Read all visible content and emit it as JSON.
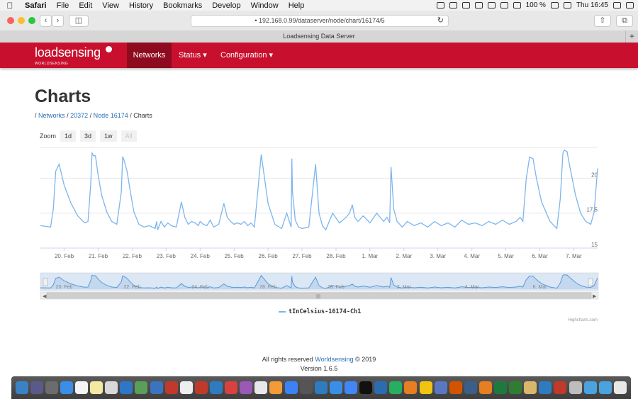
{
  "menubar": {
    "items": [
      "Safari",
      "File",
      "Edit",
      "View",
      "History",
      "Bookmarks",
      "Develop",
      "Window",
      "Help"
    ],
    "battery": "100 %",
    "clock": "Thu 16:45"
  },
  "browser": {
    "url": "192.168.0.99/dataserver/node/chart/16174/5",
    "tab_title": "Loadsensing Data Server"
  },
  "app": {
    "logo": "loadsensing",
    "logo_sub": "WORLDSENSING",
    "nav": {
      "networks": "Networks",
      "status": "Status ▾",
      "configuration": "Configuration ▾"
    }
  },
  "page": {
    "title": "Charts",
    "breadcrumb": {
      "sep": "/",
      "networks": "Networks",
      "network_id": "20372",
      "node": "Node 16174",
      "current": "Charts"
    },
    "zoom": {
      "label": "Zoom",
      "buttons": [
        "1d",
        "3d",
        "1w",
        "All"
      ]
    }
  },
  "chart_data": {
    "type": "line",
    "xlabel": "",
    "ylabel": "",
    "x_ticks": [
      "20. Feb",
      "21. Feb",
      "22. Feb",
      "23. Feb",
      "24. Feb",
      "25. Feb",
      "26. Feb",
      "27. Feb",
      "28. Feb",
      "1. Mar",
      "2. Mar",
      "3. Mar",
      "4. Mar",
      "5. Mar",
      "6. Mar",
      "7. Mar"
    ],
    "y_ticks": [
      15,
      17.5,
      20
    ],
    "ylim": [
      15,
      22.2
    ],
    "xlim": [
      -0.7,
      15.7
    ],
    "navigator_ticks": [
      "20. Feb",
      "22. Feb",
      "24. Feb",
      "26. Feb",
      "28. Feb",
      "2. Mar",
      "4. Mar",
      "6. Mar"
    ],
    "series": [
      {
        "name": "tInCelsius-16174-Ch1",
        "color": "#7cb5ec",
        "x": [
          -0.7,
          -0.4,
          -0.32,
          -0.25,
          -0.15,
          0.0,
          0.2,
          0.4,
          0.6,
          0.7,
          0.78,
          0.82,
          0.86,
          0.92,
          1.0,
          1.1,
          1.25,
          1.4,
          1.55,
          1.68,
          1.72,
          1.75,
          1.85,
          1.95,
          2.05,
          2.2,
          2.35,
          2.5,
          2.68,
          2.72,
          2.75,
          2.85,
          2.95,
          3.05,
          3.15,
          3.3,
          3.45,
          3.55,
          3.65,
          3.75,
          3.85,
          3.95,
          4.0,
          4.1,
          4.2,
          4.3,
          4.4,
          4.55,
          4.7,
          4.8,
          4.9,
          5.0,
          5.1,
          5.2,
          5.3,
          5.4,
          5.5,
          5.6,
          5.8,
          6.0,
          6.2,
          6.4,
          6.55,
          6.68,
          6.7,
          6.72,
          6.8,
          6.9,
          7.0,
          7.2,
          7.4,
          7.5,
          7.6,
          7.7,
          7.8,
          7.9,
          8.1,
          8.3,
          8.4,
          8.48,
          8.55,
          8.65,
          8.8,
          9.0,
          9.2,
          9.4,
          9.5,
          9.58,
          9.62,
          9.7,
          9.8,
          9.95,
          10.1,
          10.3,
          10.5,
          10.7,
          10.9,
          11.1,
          11.3,
          11.5,
          11.7,
          11.9,
          12.1,
          12.3,
          12.5,
          12.7,
          12.9,
          13.1,
          13.3,
          13.42,
          13.5,
          13.6,
          13.7,
          13.8,
          13.9,
          14.05,
          14.3,
          14.5,
          14.6,
          14.68,
          14.72,
          14.8,
          14.9,
          15.05,
          15.2,
          15.35,
          15.5,
          15.6,
          15.7
        ],
        "values": [
          16.6,
          16.5,
          17.8,
          20.5,
          21.0,
          19.5,
          18.2,
          17.3,
          16.8,
          16.9,
          19.5,
          21.8,
          21.6,
          21.6,
          20.2,
          18.8,
          17.6,
          16.9,
          16.7,
          19.0,
          21.5,
          21.4,
          20.5,
          19.0,
          17.6,
          16.7,
          16.5,
          16.6,
          16.4,
          16.9,
          16.3,
          16.9,
          16.5,
          16.8,
          16.6,
          16.5,
          18.3,
          17.2,
          16.7,
          16.9,
          16.8,
          16.6,
          16.9,
          16.7,
          16.6,
          17.0,
          16.5,
          16.7,
          18.2,
          17.2,
          16.9,
          16.7,
          16.8,
          16.7,
          16.9,
          16.6,
          16.8,
          16.5,
          21.7,
          18.2,
          16.7,
          16.4,
          17.5,
          16.5,
          21.4,
          19.0,
          17.0,
          16.5,
          16.4,
          16.5,
          21.0,
          17.5,
          16.6,
          16.3,
          16.9,
          17.5,
          16.8,
          17.2,
          17.5,
          18.1,
          17.2,
          16.9,
          17.3,
          16.8,
          17.5,
          16.9,
          17.2,
          16.8,
          20.8,
          17.8,
          16.9,
          16.5,
          16.9,
          16.6,
          16.8,
          16.5,
          16.9,
          16.6,
          16.8,
          16.5,
          17.0,
          16.7,
          16.8,
          16.6,
          16.9,
          16.7,
          17.0,
          16.7,
          16.9,
          17.2,
          16.9,
          20.0,
          21.5,
          21.4,
          20.0,
          18.3,
          16.9,
          16.4,
          18.5,
          21.8,
          22.0,
          21.9,
          20.6,
          18.8,
          17.5,
          16.9,
          16.7,
          17.6,
          20.7
        ]
      }
    ]
  },
  "legend": {
    "label": "tInCelsius-16174-Ch1"
  },
  "credits": "Highcharts.com",
  "footer": {
    "text": "All rights reserved",
    "company": "Worldsensing",
    "year": "© 2019",
    "version": "Version 1.6.5"
  },
  "dock": {
    "apps": [
      "#3b82c4",
      "#5a5a8a",
      "#6c6c6c",
      "#3a8ee6",
      "#f4f4f4",
      "#f3e9a2",
      "#d8d8d8",
      "#2e77c7",
      "#5a9e5a",
      "#3a74c0",
      "#c0392b",
      "#eeeeee",
      "#c0392b",
      "#2f7bbf",
      "#d94040",
      "#9b59b6",
      "#e8e8e8",
      "#f29b38",
      "#3b82f6",
      "#555555",
      "#2f7bbf",
      "#3a8ee6",
      "#4285f4",
      "#111111",
      "#2b6cb0",
      "#27ae60",
      "#e67e22",
      "#f1c40f",
      "#5a78c2",
      "#d35400",
      "#3a5f8a",
      "#e67e22",
      "#1e7a3c",
      "#2e7d32",
      "#d8b76a",
      "#2f7bbf",
      "#c0392b",
      "#bdbdbd",
      "#4aa3df",
      "#4aa3df",
      "#e8e8e8"
    ]
  }
}
